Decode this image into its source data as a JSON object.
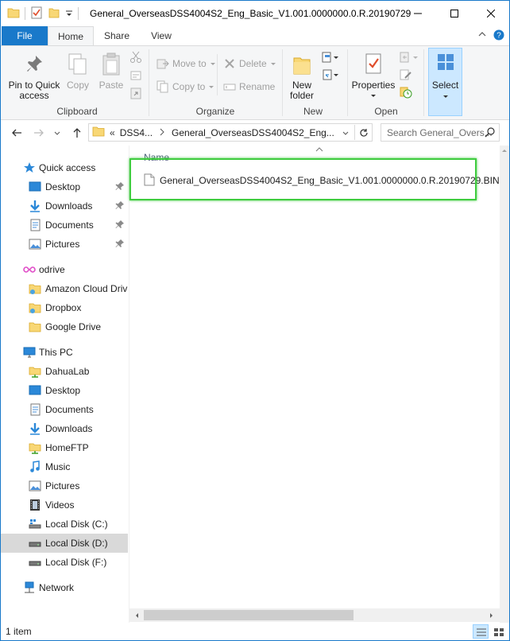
{
  "window": {
    "title": "General_OverseasDSS4004S2_Eng_Basic_V1.001.0000000.0.R.20190729",
    "colors": {
      "accent": "#1979ca",
      "highlight_box": "#3fcc3f",
      "selected_bg": "#d9d9d9"
    }
  },
  "tabs": {
    "file": "File",
    "home": "Home",
    "share": "Share",
    "view": "View"
  },
  "ribbon": {
    "pin_line1": "Pin to Quick",
    "pin_line2": "access",
    "copy": "Copy",
    "paste": "Paste",
    "clipboard": "Clipboard",
    "move_to": "Move to",
    "copy_to": "Copy to",
    "delete": "Delete",
    "rename": "Rename",
    "organize": "Organize",
    "new_folder_line1": "New",
    "new_folder_line2": "folder",
    "new": "New",
    "properties": "Properties",
    "open": "Open",
    "select": "Select"
  },
  "address": {
    "overflow": "«",
    "crumb1": "DSS4...",
    "crumb2": "General_OverseasDSS4004S2_Eng...",
    "search_placeholder": "Search General_Overs..."
  },
  "nav": {
    "quick_access": "Quick access",
    "qa_desktop": "Desktop",
    "qa_downloads": "Downloads",
    "qa_documents": "Documents",
    "qa_pictures": "Pictures",
    "odrive": "odrive",
    "amazon": "Amazon Cloud Driv",
    "dropbox": "Dropbox",
    "google_drive": "Google Drive",
    "this_pc": "This PC",
    "dahualab": "DahuaLab",
    "pc_desktop": "Desktop",
    "pc_documents": "Documents",
    "pc_downloads": "Downloads",
    "homeftp": "HomeFTP",
    "music": "Music",
    "pictures": "Pictures",
    "videos": "Videos",
    "disk_c": "Local Disk (C:)",
    "disk_d": "Local Disk (D:)",
    "disk_f": "Local Disk (F:)",
    "network": "Network"
  },
  "content": {
    "column_name": "Name",
    "files": [
      {
        "name": "General_OverseasDSS4004S2_Eng_Basic_V1.001.0000000.0.R.20190729.BIN",
        "icon": "generic-file-icon"
      }
    ]
  },
  "status": {
    "item_count": "1 item"
  }
}
